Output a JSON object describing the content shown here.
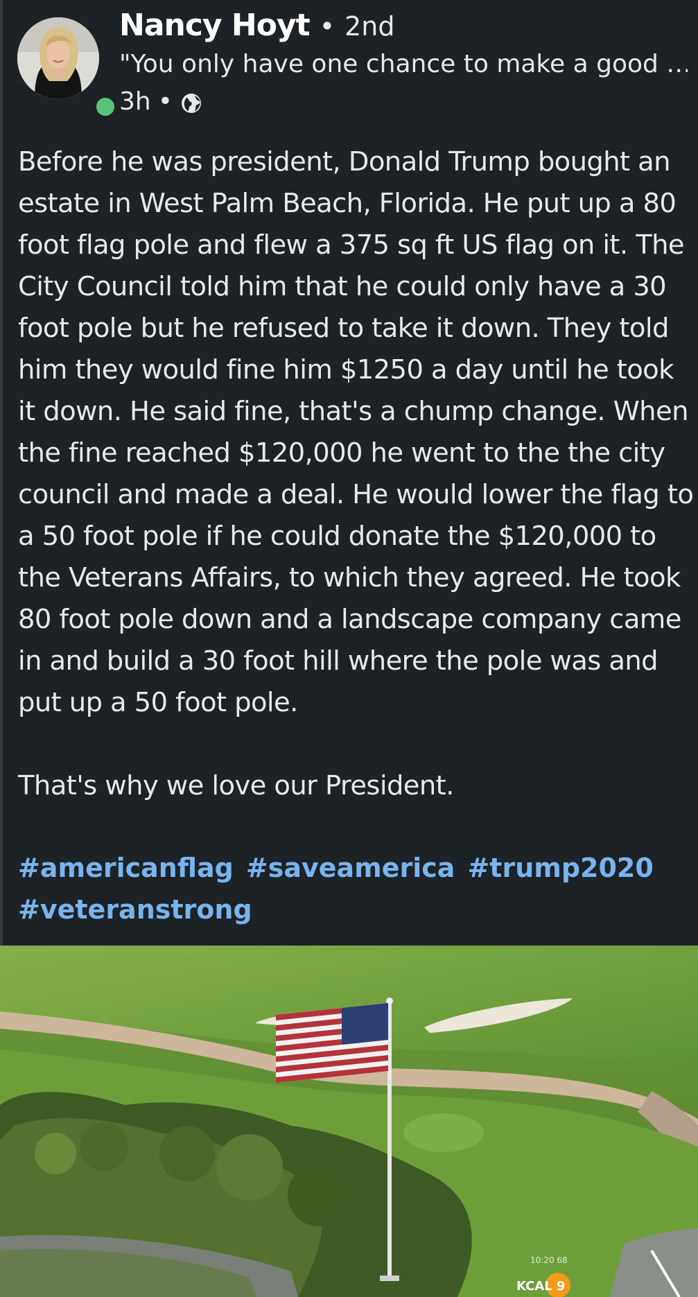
{
  "author": {
    "name": "Nancy Hoyt",
    "separator": "•",
    "degree": "2nd",
    "headline": "\"You only have one chance to make a good …",
    "time": "3h",
    "time_separator": "•",
    "visibility_icon": "globe-icon",
    "online_color": "#57c27a"
  },
  "post": {
    "body": "Before he was president, Donald Trump bought an estate in West Palm Beach, Florida. He put up a 80 foot flag pole and flew a 375 sq ft US flag on it. The City Council told him that he could only have a 30 foot pole but he refused to take it down. They told him they would fine him $1250 a day until he took it down. He said fine, that's a chump change. When the fine reached $120,000 he went to the the city council and made a deal. He would lower the flag to a 50 foot pole if he could donate the $120,000 to the Veterans Affairs, to which they agreed. He took 80 foot pole down and a landscape company came in and build a 30 foot hill where the pole was and put up a 50 foot pole.\n\nThat's why we love our President.",
    "hashtags": [
      "#americanflag",
      "#saveamerica",
      "#trump2020",
      "#veteranstrong"
    ],
    "hashtag_color": "#78b4ee"
  },
  "image": {
    "timestamp_overlay": "10:20 68",
    "station_logo": "KCAL 9"
  },
  "theme": {
    "background": "#1d2226",
    "text": "#e9e9e9"
  }
}
